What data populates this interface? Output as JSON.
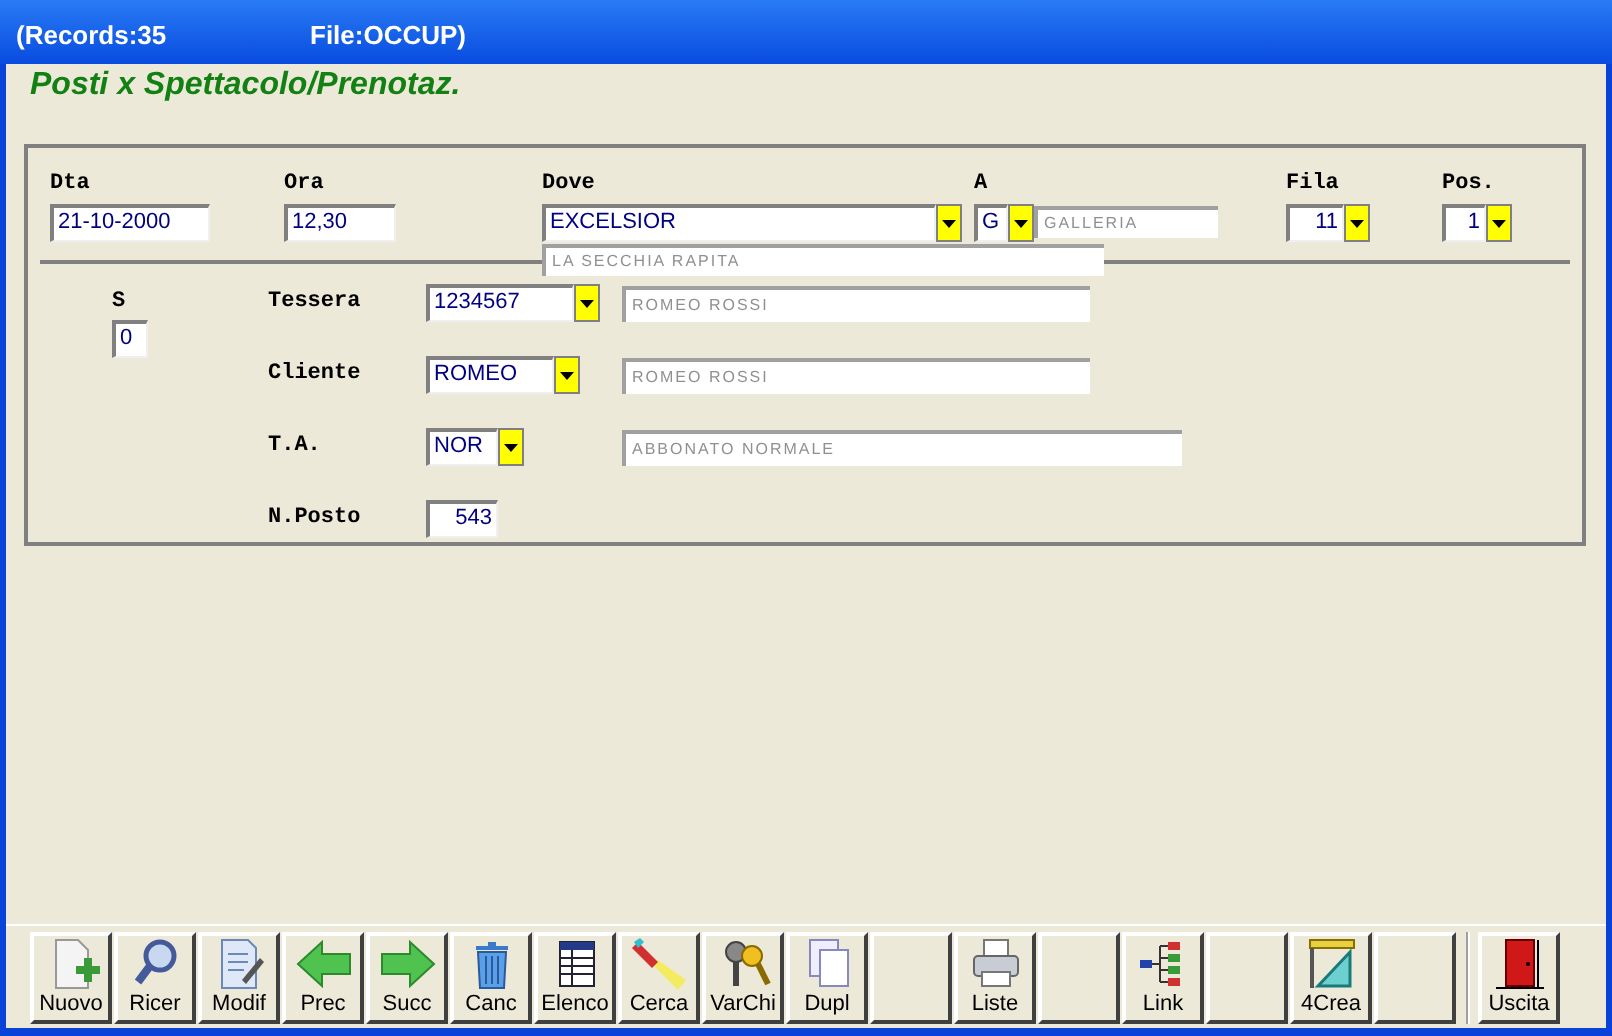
{
  "window": {
    "title_records": "(Records:35",
    "title_file": "File:OCCUP)"
  },
  "form_title": "Posti x Spettacolo/Prenotaz.",
  "header_fields": [
    {
      "label": "Dta",
      "value": "21-10-2000",
      "kind": "text"
    },
    {
      "label": "Ora",
      "value": "12,30",
      "kind": "text"
    },
    {
      "label": "Dove",
      "value": "EXCELSIOR",
      "kind": "combo",
      "subtitle": "LA SECCHIA RAPITA"
    },
    {
      "label": "A",
      "value": "G",
      "kind": "combo",
      "lookup": "GALLERIA"
    },
    {
      "label": "Fila",
      "value": "11",
      "kind": "combo"
    },
    {
      "label": "Pos.",
      "value": "1",
      "kind": "combo"
    }
  ],
  "s_field": {
    "label": "S",
    "value": "0"
  },
  "detail_fields": [
    {
      "label": "Tessera",
      "value": "1234567",
      "kind": "combo",
      "lookup": "ROMEO ROSSI"
    },
    {
      "label": "Cliente",
      "value": "ROMEO",
      "kind": "combo",
      "lookup": "ROMEO ROSSI"
    },
    {
      "label": "T.A.",
      "value": "NOR",
      "kind": "combo",
      "lookup": "ABBONATO NORMALE"
    },
    {
      "label": "N.Posto",
      "value": "543",
      "kind": "text"
    }
  ],
  "toolbar": [
    {
      "label": "Nuovo",
      "kind": "new"
    },
    {
      "label": "Ricer",
      "kind": "search"
    },
    {
      "label": "Modif",
      "kind": "edit"
    },
    {
      "label": "Prec",
      "kind": "prev"
    },
    {
      "label": "Succ",
      "kind": "next"
    },
    {
      "label": "Canc",
      "kind": "delete"
    },
    {
      "label": "Elenco",
      "kind": "list"
    },
    {
      "label": "Cerca",
      "kind": "find"
    },
    {
      "label": "VarChi",
      "kind": "keys"
    },
    {
      "label": "Dupl",
      "kind": "copy"
    },
    {
      "kind": "empty"
    },
    {
      "label": "Liste",
      "kind": "print"
    },
    {
      "kind": "empty"
    },
    {
      "label": "Link",
      "kind": "link"
    },
    {
      "kind": "empty"
    },
    {
      "label": "4Crea",
      "kind": "create"
    },
    {
      "kind": "empty"
    },
    {
      "label": "Uscita",
      "kind": "exit"
    }
  ]
}
